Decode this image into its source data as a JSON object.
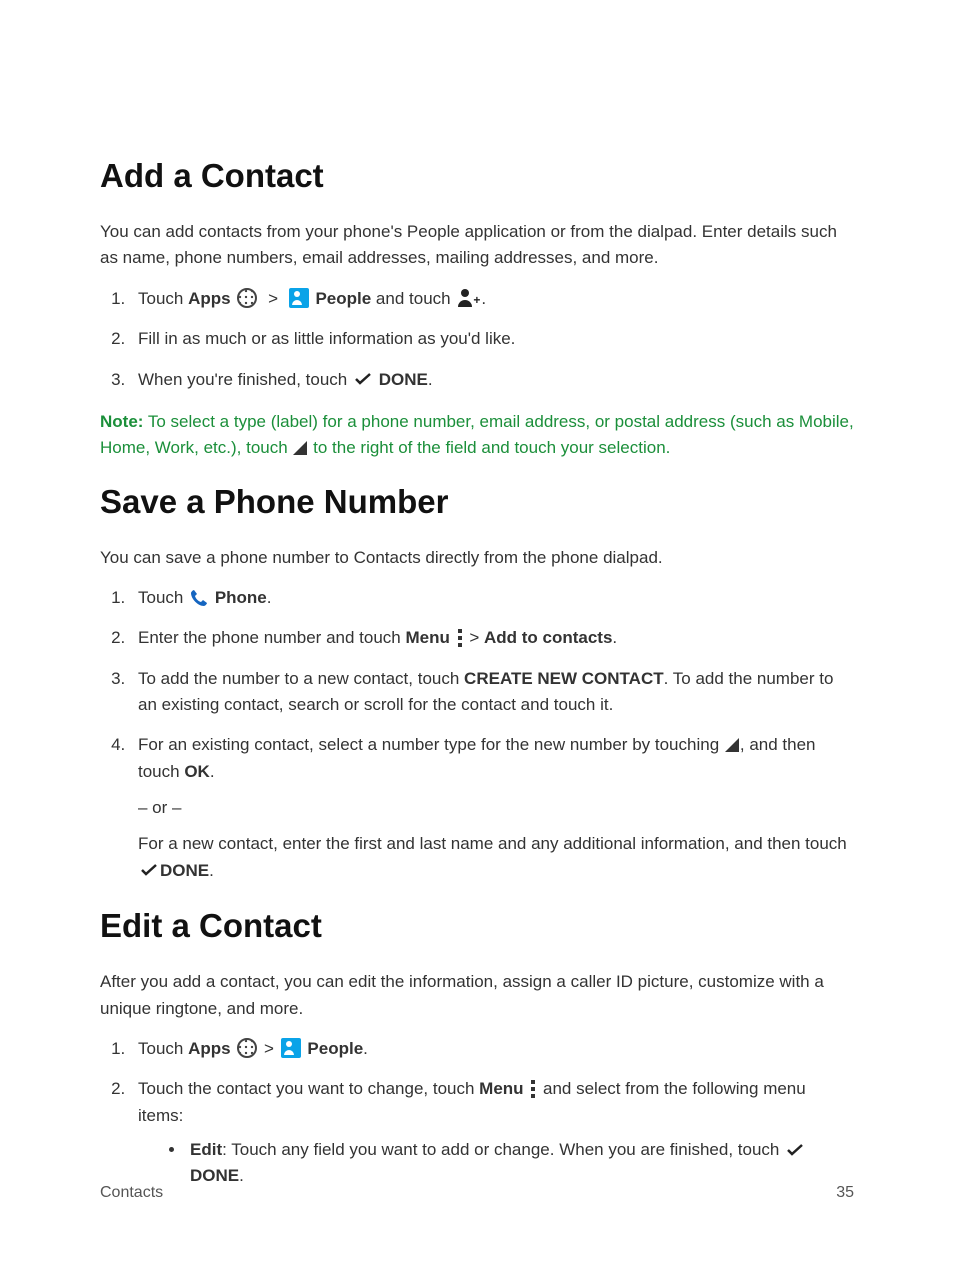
{
  "section1": {
    "heading": "Add a Contact",
    "intro": "You can add contacts from your phone's People application or from the dialpad. Enter details such as name, phone numbers, email addresses, mailing addresses, and more.",
    "step1_pre": "Touch ",
    "step1_apps": "Apps",
    "step1_chev": ">",
    "step1_people": " People",
    "step1_mid": " and touch ",
    "step1_post": ".",
    "step2": "Fill in as much or as little information as you'd like.",
    "step3_pre": "When you're finished, touch ",
    "step3_done": " DONE",
    "step3_post": ".",
    "note_label": "Note:",
    "note_t1": " To select a type (label) for a phone number, email address, or postal address (such as Mobile, Home, Work, etc.), touch ",
    "note_t2": " to the right of the field and touch your selection."
  },
  "section2": {
    "heading": "Save a Phone Number",
    "intro": "You can save a phone number to Contacts directly from the phone dialpad.",
    "s1_pre": "Touch ",
    "s1_phone": " Phone",
    "s1_post": ".",
    "s2_pre": "Enter the phone number and touch ",
    "s2_menu": "Menu",
    "s2_chev": " > ",
    "s2_add": "Add to contacts",
    "s2_post": ".",
    "s3_pre": "To add the number to a new contact, touch ",
    "s3_create": "CREATE NEW CONTACT",
    "s3_post": ". To add the number to an existing contact, search or scroll for the contact and touch it.",
    "s4_pre": "For an existing contact, select a number type for the new number by touching ",
    "s4_mid": ", and then touch ",
    "s4_ok": "OK",
    "s4_post": ".",
    "or": "– or –",
    "s4b_pre": "For a new contact, enter the first and last name and any additional information, and then touch ",
    "s4b_done": "DONE",
    "s4b_post": "."
  },
  "section3": {
    "heading": "Edit a Contact",
    "intro": "After you add a contact, you can edit the information, assign a caller ID picture, customize with a unique ringtone, and more.",
    "s1_pre": "Touch ",
    "s1_apps": "Apps",
    "s1_chev": " > ",
    "s1_people": " People",
    "s1_post": ".",
    "s2_pre": "Touch the contact you want to change, touch ",
    "s2_menu": "Menu",
    "s2_post": " and select from the following menu items:",
    "bullet_edit_label": "Edit",
    "bullet_edit_pre": ": Touch any field you want to add or change. When you are finished, touch ",
    "bullet_edit_done": " DONE",
    "bullet_edit_post": "."
  },
  "footer": {
    "left": "Contacts",
    "right": "35"
  }
}
